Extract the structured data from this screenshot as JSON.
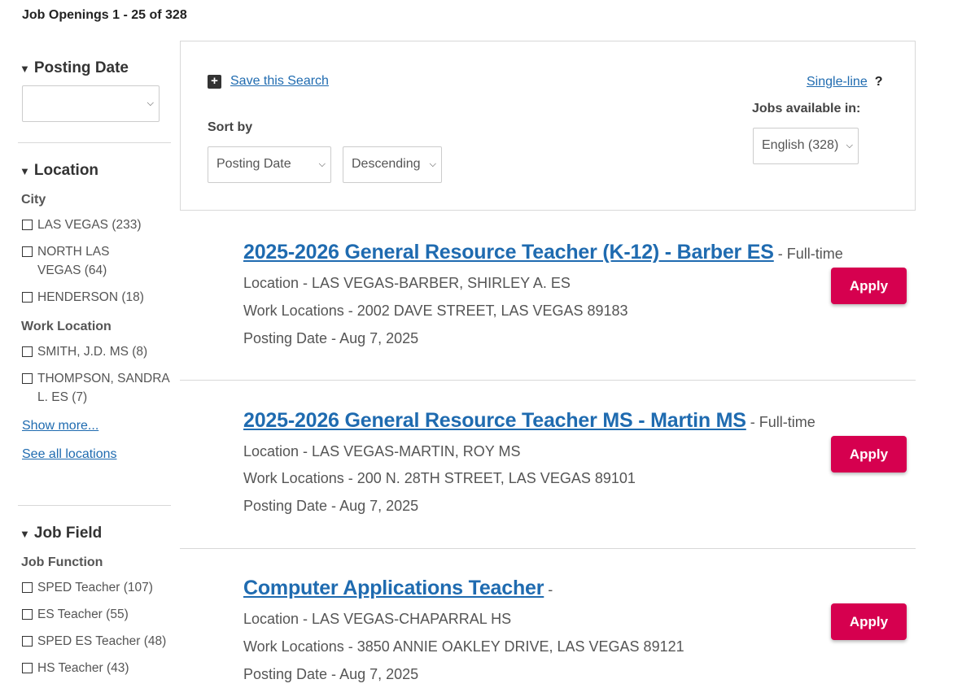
{
  "heading": "Job Openings 1 - 25 of 328",
  "sidebar": {
    "posting_date": {
      "title": "Posting Date",
      "selected": ""
    },
    "location": {
      "title": "Location",
      "city_label": "City",
      "cities": [
        {
          "name": "LAS VEGAS",
          "count": "(233)",
          "checked": false
        },
        {
          "name": "NORTH LAS VEGAS",
          "count": "(64)",
          "checked": false
        },
        {
          "name": "HENDERSON",
          "count": "(18)",
          "checked": false
        }
      ],
      "work_location_label": "Work Location",
      "work_locations": [
        {
          "name": "SMITH, J.D. MS",
          "count": "(8)",
          "checked": false
        },
        {
          "name": "THOMPSON, SANDRA L. ES",
          "count": "(7)",
          "checked": false
        }
      ],
      "show_more": "Show more...",
      "see_all": "See all locations"
    },
    "job_field": {
      "title": "Job Field",
      "function_label": "Job Function",
      "functions": [
        {
          "name": "SPED Teacher",
          "count": "(107)",
          "checked": false
        },
        {
          "name": "ES Teacher",
          "count": "(55)",
          "checked": false
        },
        {
          "name": "SPED ES Teacher",
          "count": "(48)",
          "checked": false
        },
        {
          "name": "HS Teacher",
          "count": "(43)",
          "checked": false
        }
      ]
    }
  },
  "toolbar": {
    "save_search": "Save this Search",
    "sort_by_label": "Sort by",
    "sort_field": "Posting Date",
    "sort_order": "Descending",
    "single_line": "Single-line",
    "help": "?",
    "jobs_available_label": "Jobs available in:",
    "language": "English (328)"
  },
  "jobs": [
    {
      "title": "2025-2026 General Resource Teacher (K-12) - Barber ES",
      "type": " - Full-time",
      "location": "Location - LAS VEGAS-BARBER, SHIRLEY A. ES",
      "work_locations": "Work Locations - 2002 DAVE STREET, LAS VEGAS 89183",
      "posting_date": "Posting Date - Aug 7, 2025",
      "apply": "Apply"
    },
    {
      "title": "2025-2026 General Resource Teacher MS - Martin MS",
      "type": " - Full-time",
      "location": "Location - LAS VEGAS-MARTIN, ROY MS",
      "work_locations": "Work Locations - 200 N. 28TH STREET, LAS VEGAS 89101",
      "posting_date": "Posting Date - Aug 7, 2025",
      "apply": "Apply"
    },
    {
      "title": "Computer Applications Teacher",
      "type": " -",
      "location": "Location - LAS VEGAS-CHAPARRAL HS",
      "work_locations": "Work Locations - 3850 ANNIE OAKLEY DRIVE, LAS VEGAS 89121",
      "posting_date": "Posting Date - Aug 7, 2025",
      "apply": "Apply"
    }
  ],
  "colors": {
    "link": "#1f6bb0",
    "apply_button": "#d6004f"
  },
  "icons": {
    "plus": "plus-icon",
    "help": "help-icon",
    "triangle": "triangle-down-icon",
    "chevron": "chevron-down-icon"
  }
}
